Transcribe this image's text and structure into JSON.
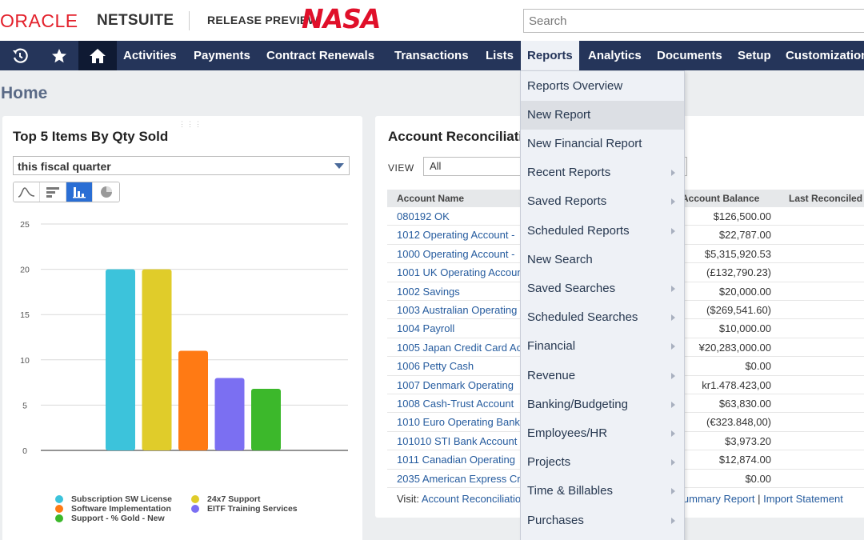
{
  "header": {
    "oracle_logo": "ORACLE",
    "netsuite_logo": "NETSUITE",
    "release_preview": "RELEASE PREVIEW",
    "nasa_logo": "NASA",
    "search_placeholder": "Search"
  },
  "nav": {
    "icons": [
      "recent-icon",
      "star-icon",
      "home-icon"
    ],
    "items": [
      "Activities",
      "Payments",
      "Contract Renewals",
      "Transactions",
      "Lists",
      "Reports",
      "Analytics",
      "Documents",
      "Setup",
      "Customization"
    ],
    "active": "Reports"
  },
  "page": {
    "title": "Home"
  },
  "top_items": {
    "title": "Top 5 Items By Qty Sold",
    "period": "this fiscal quarter",
    "chart_type_icons": [
      "line-chart-icon",
      "horizontal-bar-icon",
      "bar-chart-icon",
      "pie-chart-icon"
    ],
    "active_chart_type": "bar"
  },
  "chart_data": {
    "type": "bar",
    "categories": [
      "Subscription SW License",
      "24x7 Support",
      "Software Implementation",
      "EITF Training Services",
      "Support - % Gold - New"
    ],
    "values": [
      20,
      20,
      11,
      8,
      6.8
    ],
    "colors": [
      "#3cc3db",
      "#e0cc2a",
      "#ff7a14",
      "#7b6ff2",
      "#3cb82b"
    ],
    "yticks": [
      0,
      5,
      10,
      15,
      20,
      25
    ],
    "ylim": [
      0,
      25
    ],
    "grid": true,
    "legend": "bottom"
  },
  "reconciliation": {
    "title": "Account Reconciliation",
    "view_label": "VIEW",
    "view_value": "All",
    "columns": {
      "name": "Account Name",
      "balance": "Account Balance",
      "last": "Last Reconciled"
    },
    "rows": [
      {
        "name": "080192 OK",
        "balance": "$126,500.00"
      },
      {
        "name": "1012 Operating Account - ",
        "balance": "$22,787.00"
      },
      {
        "name": "1000 Operating Account - ",
        "balance": "$5,315,920.53"
      },
      {
        "name": "1001 UK Operating Accoun",
        "balance": "(£132,790.23)"
      },
      {
        "name": "1002 Savings",
        "balance": "$20,000.00"
      },
      {
        "name": "1003 Australian Operating",
        "balance": "($269,541.60)"
      },
      {
        "name": "1004 Payroll",
        "balance": "$10,000.00"
      },
      {
        "name": "1005 Japan Credit Card Ac",
        "balance": "¥20,283,000.00"
      },
      {
        "name": "1006 Petty Cash",
        "balance": "$0.00"
      },
      {
        "name": "1007 Denmark Operating ",
        "balance": "kr1.478.423,00"
      },
      {
        "name": "1008 Cash-Trust Account",
        "balance": "$63,830.00"
      },
      {
        "name": "1010 Euro Operating Bank",
        "balance": "(€323.848,00)"
      },
      {
        "name": "101010 STI Bank Account",
        "balance": "$3,973.20"
      },
      {
        "name": "1011 Canadian Operating",
        "balance": "$12,874.00"
      },
      {
        "name": "2035 American Express Cr",
        "balance": "$0.00"
      }
    ],
    "visit_label": "Visit:",
    "visit_link1": "Account Reconciliatio",
    "visit_link2": "n Summary Report",
    "visit_sep": "|",
    "visit_link3": "Import Statement"
  },
  "reports_menu": {
    "items": [
      {
        "label": "Reports Overview",
        "submenu": false
      },
      {
        "label": "New Report",
        "submenu": false
      },
      {
        "label": "New Financial Report",
        "submenu": false
      },
      {
        "label": "Recent Reports",
        "submenu": true
      },
      {
        "label": "Saved Reports",
        "submenu": true
      },
      {
        "label": "Scheduled Reports",
        "submenu": true
      },
      {
        "label": "New Search",
        "submenu": false
      },
      {
        "label": "Saved Searches",
        "submenu": true
      },
      {
        "label": "Scheduled Searches",
        "submenu": true
      },
      {
        "label": "Financial",
        "submenu": true
      },
      {
        "label": "Revenue",
        "submenu": true
      },
      {
        "label": "Banking/Budgeting",
        "submenu": true
      },
      {
        "label": "Employees/HR",
        "submenu": true
      },
      {
        "label": "Projects",
        "submenu": true
      },
      {
        "label": "Time & Billables",
        "submenu": true
      },
      {
        "label": "Purchases",
        "submenu": true
      }
    ],
    "hovered": "New Report"
  }
}
